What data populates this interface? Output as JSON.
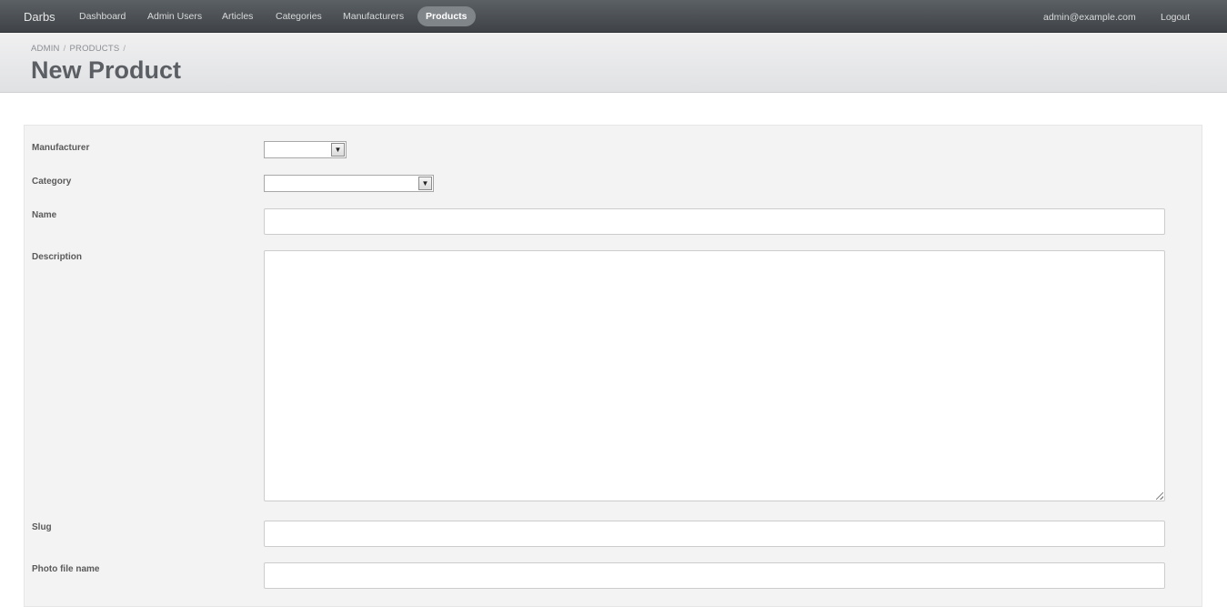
{
  "nav": {
    "brand": "Darbs",
    "items": [
      {
        "label": "Dashboard"
      },
      {
        "label": "Admin Users"
      },
      {
        "label": "Articles"
      },
      {
        "label": "Categories"
      },
      {
        "label": "Manufacturers"
      },
      {
        "label": "Products",
        "active": true
      }
    ],
    "user_email": "admin@example.com",
    "logout_label": "Logout"
  },
  "header": {
    "breadcrumb": [
      "ADMIN",
      "PRODUCTS"
    ],
    "breadcrumb_separator": "/",
    "title": "New Product"
  },
  "form": {
    "manufacturer_label": "Manufacturer",
    "manufacturer_value": "",
    "category_label": "Category",
    "category_value": "",
    "name_label": "Name",
    "name_value": "",
    "description_label": "Description",
    "description_value": "",
    "slug_label": "Slug",
    "slug_value": "",
    "photo_label": "Photo file name",
    "photo_value": ""
  },
  "colors": {
    "topbar": "#4a4e52",
    "active_nav": "#80858a",
    "title_text": "#5b5f64",
    "panel_bg": "#f3f3f3"
  }
}
